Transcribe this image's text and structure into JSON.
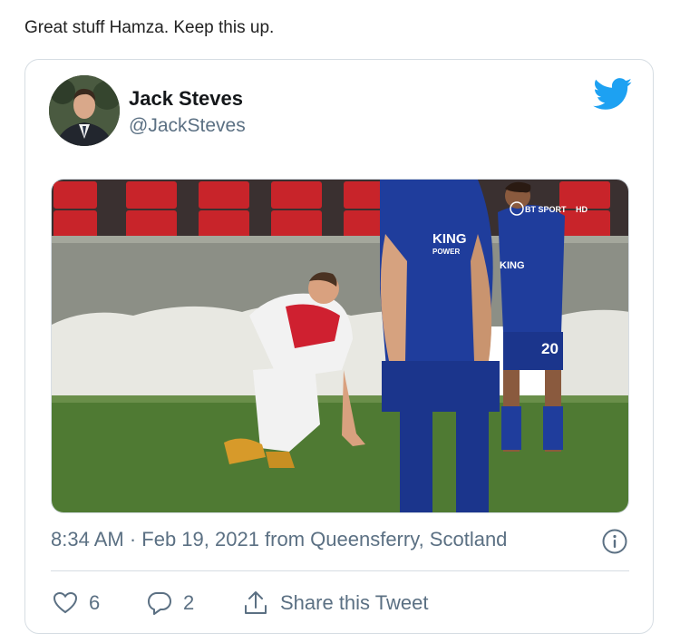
{
  "caption": "Great stuff Hamza. Keep this up.",
  "tweet": {
    "author_name": "Jack Steves",
    "author_handle": "@JackSteves",
    "timestamp": "8:34 AM · Feb 19, 2021 from Queensferry, Scotland",
    "likes": "6",
    "replies": "2",
    "share_label": "Share this Tweet",
    "media": {
      "jersey_text_1": "KING",
      "jersey_text_2": "POWER",
      "shirt_number": "20",
      "broadcast_logo": "BT SPORT",
      "broadcast_hd": "HD"
    }
  },
  "icons": {
    "logo": "twitter-bird-icon",
    "info": "info-icon",
    "like": "heart-icon",
    "reply": "reply-icon",
    "share": "share-icon"
  },
  "colors": {
    "twitter_blue": "#1da1f2",
    "secondary_text": "#5b7083",
    "border": "#d6dde3"
  }
}
